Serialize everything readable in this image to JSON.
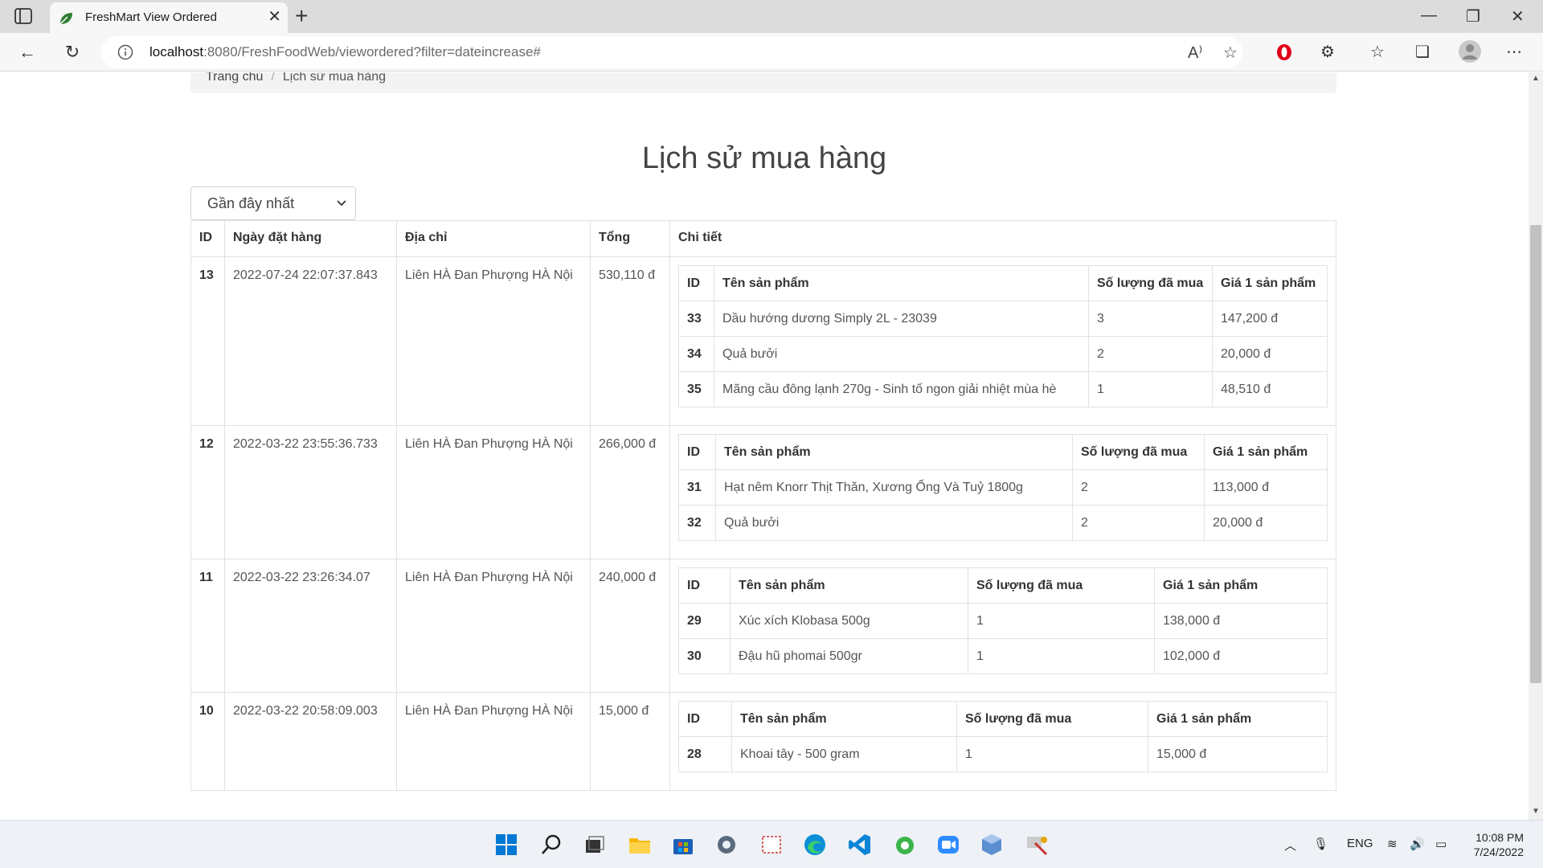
{
  "browser": {
    "tab_title": "FreshMart View Ordered",
    "url_host": "localhost",
    "url_rest": ":8080/FreshFoodWeb/viewordered?filter=dateincrease#"
  },
  "breadcrumb": {
    "home": "Trang chủ",
    "current": "Lịch sử mua hàng"
  },
  "page": {
    "title": "Lịch sử mua hàng",
    "filter_selected": "Gần đây nhất"
  },
  "orders_table": {
    "headers": [
      "ID",
      "Ngày đặt hàng",
      "Địa chỉ",
      "Tổng",
      "Chi tiết"
    ],
    "detail_headers": [
      "ID",
      "Tên sản phẩm",
      "Số lượng đã mua",
      "Giá 1 sản phẩm"
    ],
    "orders": [
      {
        "id": "13",
        "date": "2022-07-24 22:07:37.843",
        "address": "Liên HÀ Đan Phượng HÀ Nội",
        "total": "530,110 đ",
        "items": [
          {
            "id": "33",
            "name": "Dầu hướng dương Simply 2L - 23039",
            "qty": "3",
            "price": "147,200 đ"
          },
          {
            "id": "34",
            "name": "Quả bưởi",
            "qty": "2",
            "price": "20,000 đ"
          },
          {
            "id": "35",
            "name": "Mãng cầu đông lạnh 270g - Sinh tố ngon giải nhiệt mùa hè",
            "qty": "1",
            "price": "48,510 đ"
          }
        ]
      },
      {
        "id": "12",
        "date": "2022-03-22 23:55:36.733",
        "address": "Liên HÀ Đan Phượng HÀ Nội",
        "total": "266,000 đ",
        "items": [
          {
            "id": "31",
            "name": "Hạt nêm Knorr Thịt Thăn, Xương Ống Và Tuỷ 1800g",
            "qty": "2",
            "price": "113,000 đ"
          },
          {
            "id": "32",
            "name": "Quả bưởi",
            "qty": "2",
            "price": "20,000 đ"
          }
        ]
      },
      {
        "id": "11",
        "date": "2022-03-22 23:26:34.07",
        "address": "Liên HÀ Đan Phượng HÀ Nội",
        "total": "240,000 đ",
        "items": [
          {
            "id": "29",
            "name": "Xúc xích Klobasa 500g",
            "qty": "1",
            "price": "138,000 đ"
          },
          {
            "id": "30",
            "name": "Đậu hũ phomai 500gr",
            "qty": "1",
            "price": "102,000 đ"
          }
        ]
      },
      {
        "id": "10",
        "date": "2022-03-22 20:58:09.003",
        "address": "Liên HÀ Đan Phượng HÀ Nội",
        "total": "15,000 đ",
        "items": [
          {
            "id": "28",
            "name": "Khoai tây - 500 gram",
            "qty": "1",
            "price": "15,000 đ"
          }
        ]
      }
    ]
  },
  "taskbar": {
    "lang": "ENG",
    "time": "10:08 PM",
    "date": "7/24/2022"
  },
  "colors": {
    "accent": "#0078d4",
    "edge_green": "#2e7d32"
  }
}
